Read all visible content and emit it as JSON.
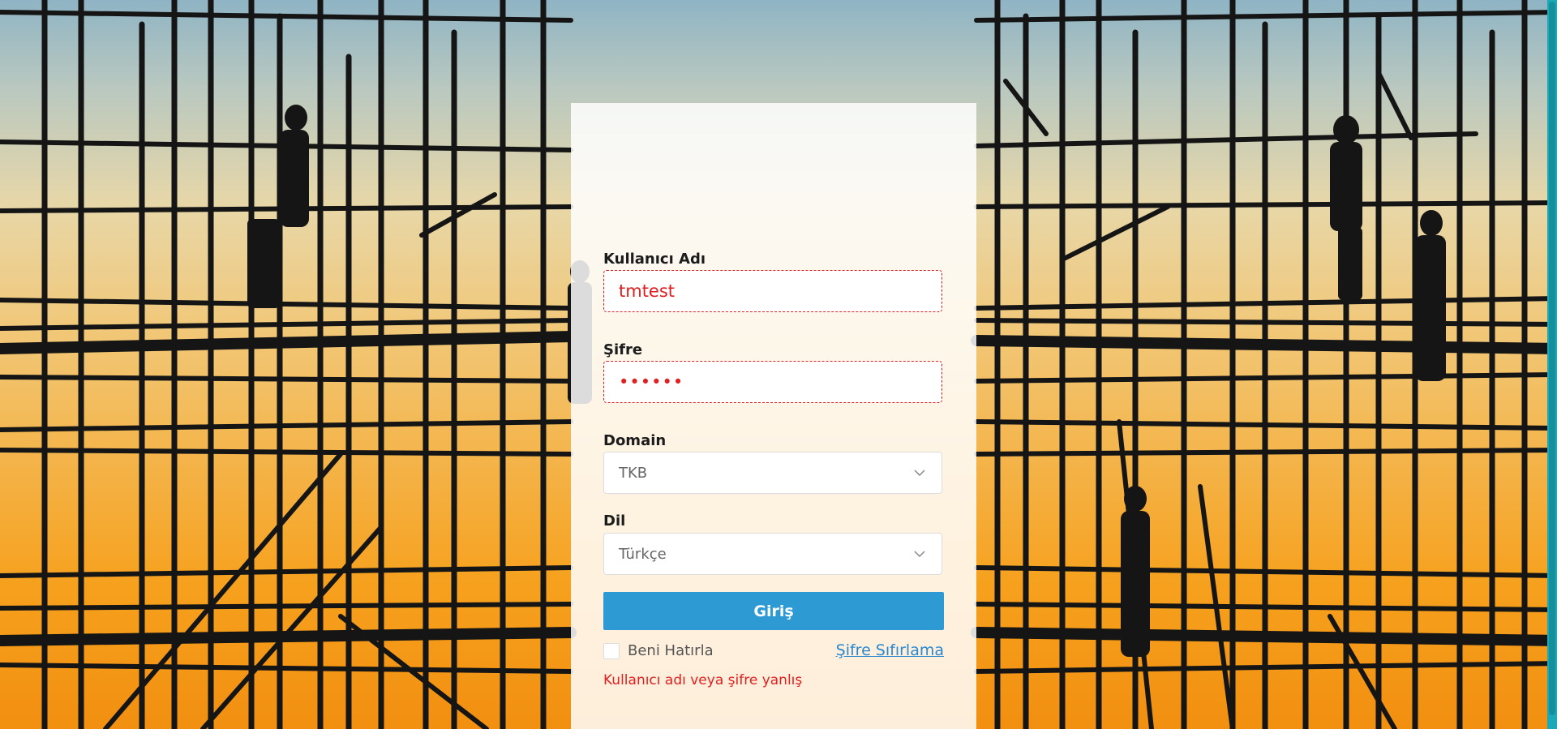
{
  "form": {
    "username_label": "Kullanıcı Adı",
    "username_value": "tmtest",
    "password_label": "Şifre",
    "password_value": "••••••",
    "domain_label": "Domain",
    "domain_value": "TKB",
    "language_label": "Dil",
    "language_value": "Türkçe",
    "login_button": "Giriş",
    "remember_label": "Beni Hatırla",
    "reset_link": "Şifre Sıfırlama",
    "error_message": "Kullanıcı adı veya şifre yanlış"
  },
  "icons": {
    "chevron": "chevron-down-icon"
  },
  "colors": {
    "primary_button": "#2e9ad4",
    "error": "#e02020",
    "link": "#2a88d0"
  }
}
